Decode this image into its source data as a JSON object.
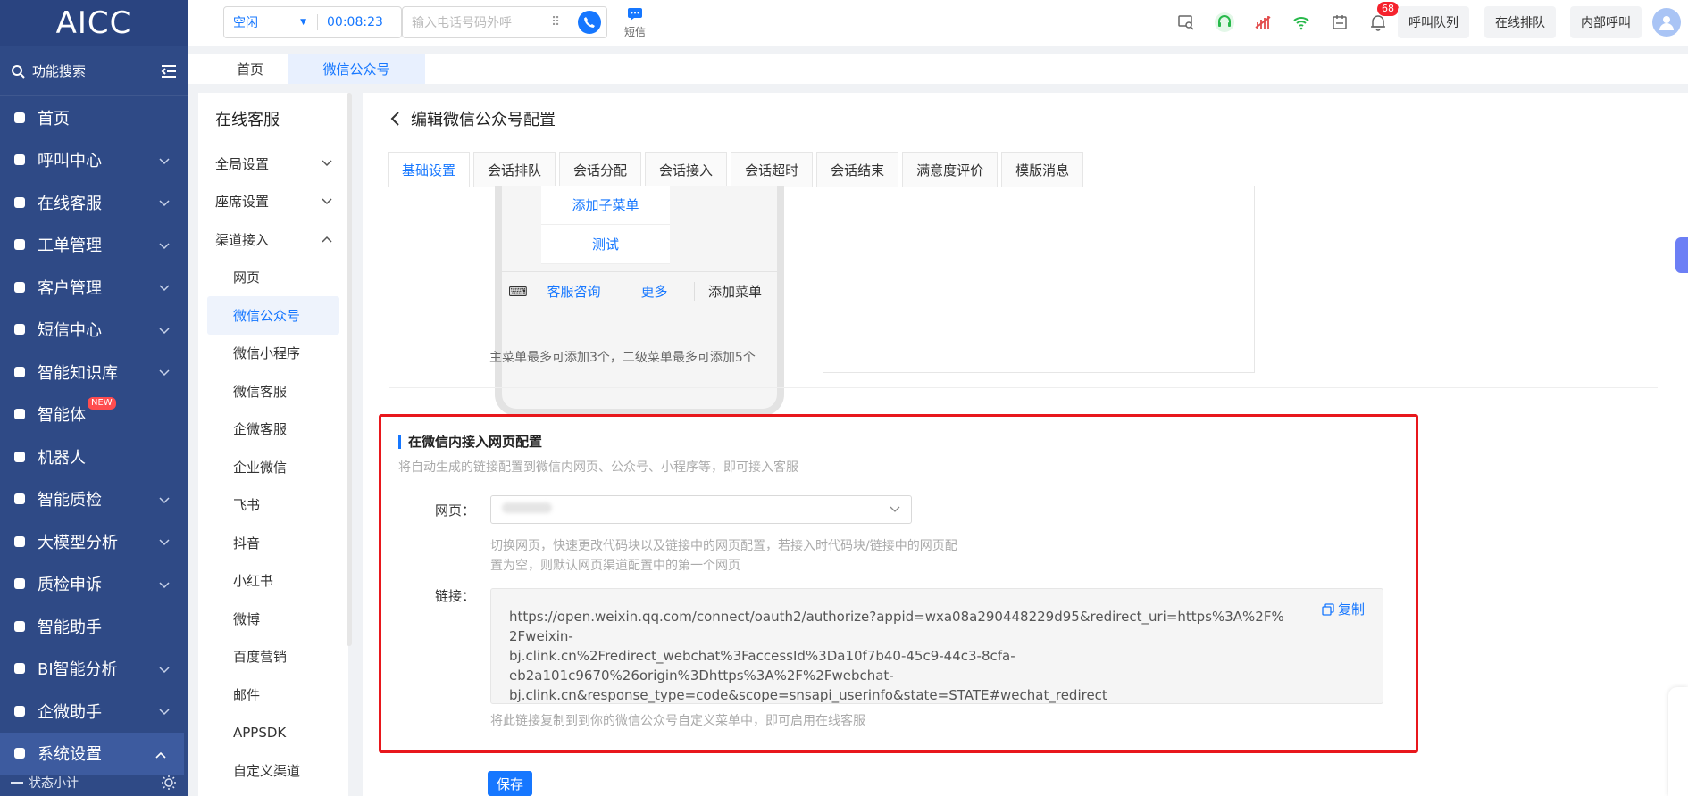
{
  "app": {
    "logo": "AICC"
  },
  "sidebar": {
    "search_label": "功能搜索",
    "items": [
      {
        "label": "首页",
        "icon": "home-icon",
        "has_chevron": false
      },
      {
        "label": "呼叫中心",
        "icon": "phone-icon",
        "has_chevron": true
      },
      {
        "label": "在线客服",
        "icon": "chat-icon",
        "has_chevron": true
      },
      {
        "label": "工单管理",
        "icon": "clipboard-icon",
        "has_chevron": true
      },
      {
        "label": "客户管理",
        "icon": "users-icon",
        "has_chevron": true
      },
      {
        "label": "短信中心",
        "icon": "mail-icon",
        "has_chevron": true
      },
      {
        "label": "智能知识库",
        "icon": "library-icon",
        "has_chevron": true
      },
      {
        "label": "智能体",
        "icon": "apps-icon",
        "has_chevron": false,
        "badge": "NEW"
      },
      {
        "label": "机器人",
        "icon": "robot-icon",
        "has_chevron": false
      },
      {
        "label": "智能质检",
        "icon": "inspect-icon",
        "has_chevron": true
      },
      {
        "label": "大模型分析",
        "icon": "analysis-icon",
        "has_chevron": true
      },
      {
        "label": "质检申诉",
        "icon": "shield-icon",
        "has_chevron": true
      },
      {
        "label": "智能助手",
        "icon": "assistant-icon",
        "has_chevron": false
      },
      {
        "label": "BI智能分析",
        "icon": "pie-icon",
        "has_chevron": true
      },
      {
        "label": "企微助手",
        "icon": "wechat-icon",
        "has_chevron": true
      },
      {
        "label": "系统设置",
        "icon": "grid-icon",
        "has_chevron": true,
        "active": true
      }
    ],
    "status_label": "状态小计"
  },
  "topbar": {
    "status": "空闲",
    "timer": "00:08:23",
    "dial_placeholder": "输入电话号码外呼",
    "sms_label": "短信",
    "notification_count": "68",
    "buttons": [
      "呼叫队列",
      "在线排队",
      "内部呼叫"
    ]
  },
  "page_tabs": [
    "首页",
    "微信公众号"
  ],
  "submenu": {
    "title": "在线客服",
    "groups": [
      "全局设置",
      "座席设置",
      "渠道接入"
    ],
    "channels": [
      "网页",
      "微信公众号",
      "微信小程序",
      "微信客服",
      "企微客服",
      "企业微信",
      "飞书",
      "抖音",
      "小红书",
      "微博",
      "百度营销",
      "邮件",
      "APPSDK",
      "自定义渠道"
    ]
  },
  "main": {
    "title": "编辑微信公众号配置",
    "tabs": [
      "基础设置",
      "会话排队",
      "会话分配",
      "会话接入",
      "会话超时",
      "会话结束",
      "满意度评价",
      "模版消息"
    ],
    "phone": {
      "sub_items": [
        "添加子菜单",
        "测试"
      ],
      "bottom": [
        "客服咨询",
        "更多",
        "添加菜单"
      ]
    },
    "menu_hint": "主菜单最多可添加3个，二级菜单最多可添加5个",
    "web_section": {
      "title": "在微信内接入网页配置",
      "desc": "将自动生成的链接配置到微信内网页、公众号、小程序等，即可接入客服",
      "web_label": "网页：",
      "web_help_1": "切换网页，快速更改代码块以及链接中的网页配置，若接入时代码块/链接中的网页配",
      "web_help_2": "置为空，则默认网页渠道配置中的第一个网页",
      "link_label": "链接：",
      "link_line_1": "https://open.weixin.qq.com/connect/oauth2/authorize?appid=wxa08a290448229d95&redirect_uri=https%3A%2F%2Fweixin-",
      "link_line_2": "bj.clink.cn%2Fredirect_webchat%3FaccessId%3Da10f7b40-45c9-44c3-8cfa-",
      "link_line_3": "eb2a101c9670%26origin%3Dhttps%3A%2F%2Fwebchat-",
      "link_line_4": "bj.clink.cn&response_type=code&scope=snsapi_userinfo&state=STATE#wechat_redirect",
      "copy_label": "复制",
      "link_help": "将此链接复制到到你的微信公众号自定义菜单中，即可启用在线客服"
    },
    "save_label": "保存"
  }
}
